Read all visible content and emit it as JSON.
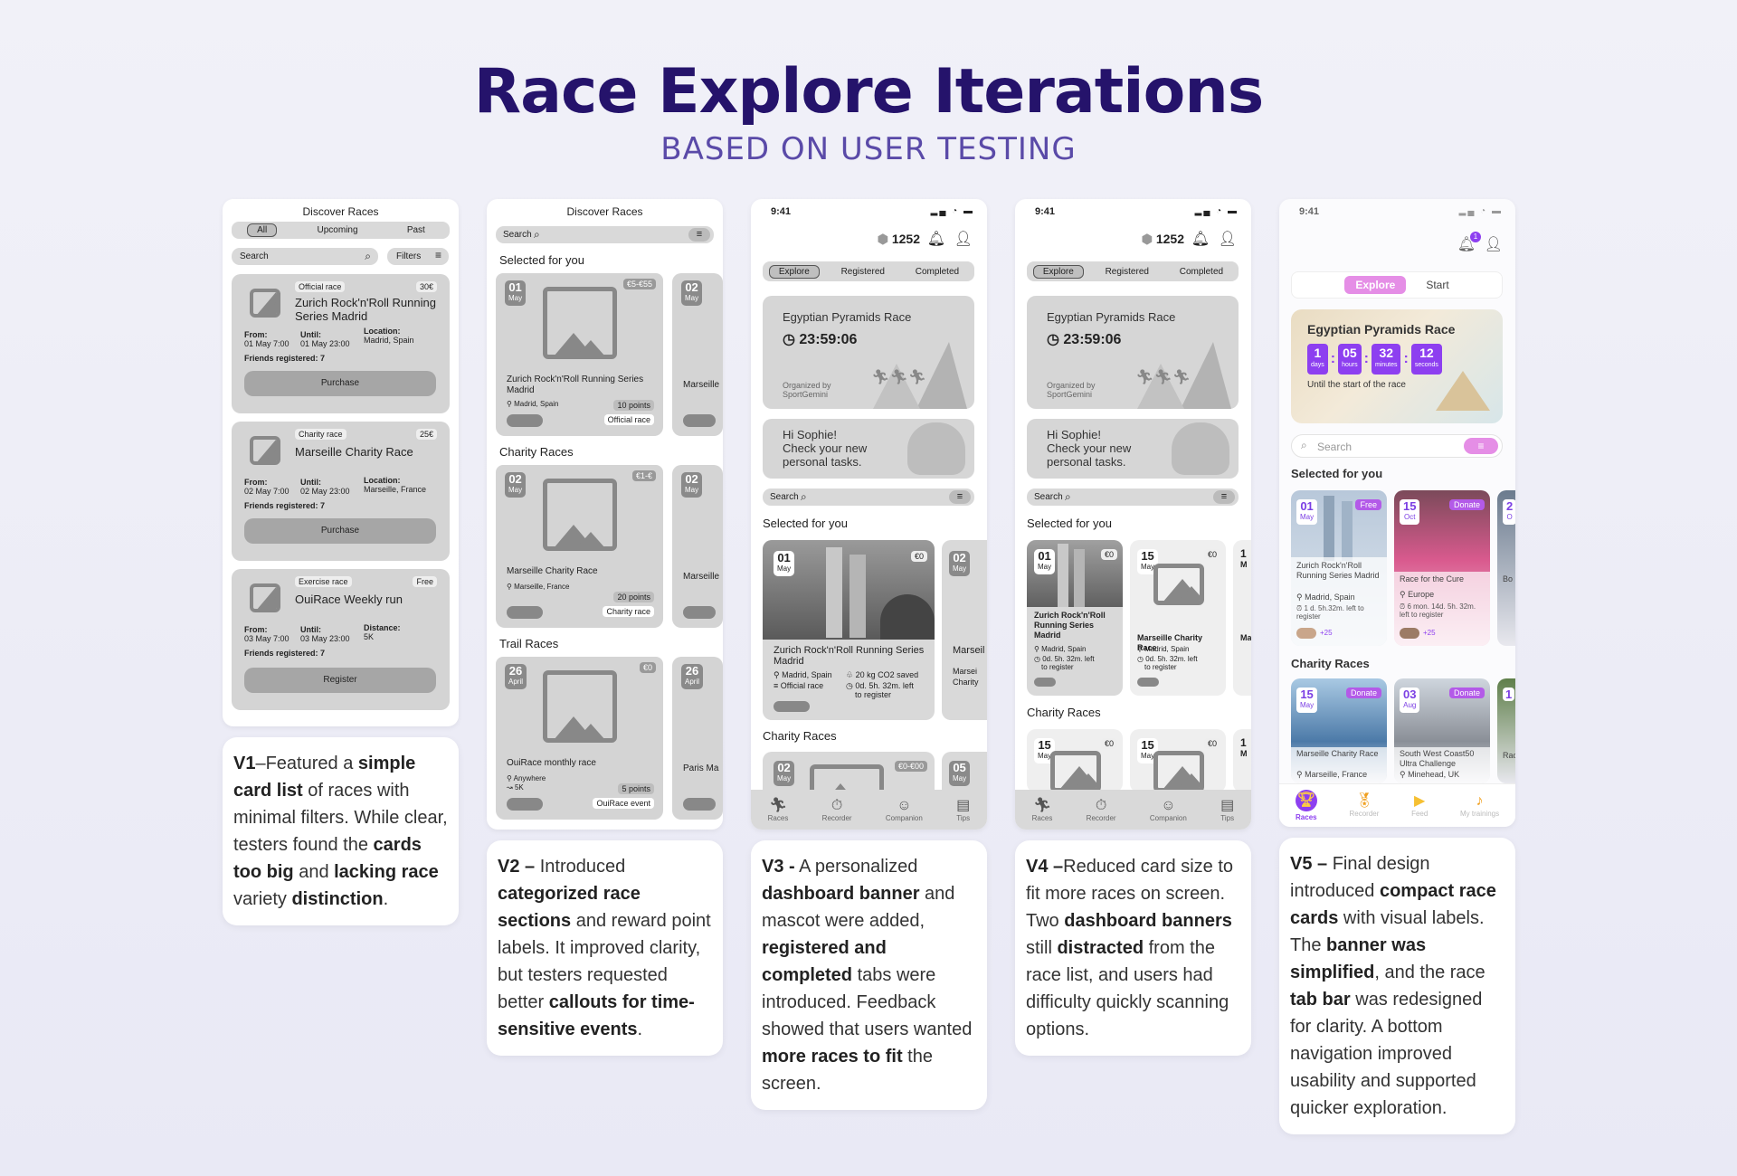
{
  "header": {
    "title": "Race Explore Iterations",
    "subtitle": "BASED ON USER TESTING"
  },
  "v1": {
    "title": "Discover Races",
    "tabs": [
      "All",
      "Upcoming",
      "Past"
    ],
    "search": "Search",
    "filters": "Filters",
    "cards": [
      {
        "tag": "Official race",
        "price": "30€",
        "name": "Zurich Rock'n'Roll Running Series Madrid",
        "from": "From:",
        "from_v": "01 May 7:00",
        "until": "Until:",
        "until_v": "01 May 23:00",
        "loc": "Location:",
        "loc_v": "Madrid, Spain",
        "friends": "Friends registered: 7",
        "btn": "Purchase"
      },
      {
        "tag": "Charity race",
        "price": "25€",
        "name": "Marseille Charity Race",
        "from": "From:",
        "from_v": "02 May 7:00",
        "until": "Until:",
        "until_v": "02 May 23:00",
        "loc": "Location:",
        "loc_v": "Marseille, France",
        "friends": "Friends registered: 7",
        "btn": "Purchase"
      },
      {
        "tag": "Exercise race",
        "price": "Free",
        "name": "OuiRace Weekly run",
        "from": "From:",
        "from_v": "03 May 7:00",
        "until": "Until:",
        "until_v": "03 May 23:00",
        "loc": "Distance:",
        "loc_v": "5K",
        "friends": "Friends registered: 7",
        "btn": "Register"
      }
    ],
    "desc_parts": [
      "V1",
      "–Featured a ",
      "simple card list",
      " of races with minimal filters. While clear, testers found the ",
      "cards too big",
      " and ",
      "lacking race",
      " variety ",
      "distinction",
      "."
    ]
  },
  "v2": {
    "title": "Discover Races",
    "search": "Search",
    "sections": [
      {
        "label": "Selected for you",
        "day": "01",
        "month": "May",
        "price": "€5-€55",
        "name": "Zurich Rock'n'Roll Running Series Madrid",
        "loc": "Madrid, Spain",
        "points": "10 points",
        "type": "Official race",
        "peek_day": "02",
        "peek_month": "May",
        "peek_name": "Marseille"
      },
      {
        "label": "Charity Races",
        "day": "02",
        "month": "May",
        "price": "€1-€",
        "name": "Marseille Charity Race",
        "loc": "Marseille, France",
        "points": "20 points",
        "type": "Charity race",
        "peek_day": "02",
        "peek_month": "May",
        "peek_name": "Marseille"
      },
      {
        "label": "Trail Races",
        "day": "26",
        "month": "April",
        "price": "€0",
        "name": "OuiRace monthly race",
        "loc": "Anywhere",
        "dist": "5K",
        "points": "5 points",
        "type": "OuiRace event",
        "peek_day": "26",
        "peek_month": "April",
        "peek_name": "Paris Ma"
      }
    ],
    "desc_parts": [
      "V2 –",
      " Introduced ",
      "categorized race sections",
      " and reward point labels. It improved clarity, but testers requested better ",
      "callouts for time-sensitive events",
      "."
    ]
  },
  "v3": {
    "time": "9:41",
    "coins": "1252",
    "tabs": [
      "Explore",
      "Registered",
      "Completed"
    ],
    "banner": {
      "title": "Egyptian Pyramids Race",
      "timer": "23:59:06",
      "org1": "Organized by",
      "org2": "SportGemini"
    },
    "mascot": {
      "l1": "Hi Sophie!",
      "l2": "Check your new",
      "l3": "personal tasks."
    },
    "search": "Search",
    "selected": "Selected for you",
    "card": {
      "day": "01",
      "month": "May",
      "price": "€0",
      "name": "Zurich Rock'n'Roll Running Series Madrid",
      "loc": "Madrid, Spain",
      "co2": "20 kg CO2 saved",
      "type": "Official race",
      "left1": "0d. 5h. 32m. left",
      "left2": "to register"
    },
    "peek": {
      "day": "02",
      "month": "May",
      "name": "Marseil",
      "loc": "Marsei",
      "type": "Charity"
    },
    "charity": "Charity Races",
    "charity_card": {
      "day": "02",
      "month": "May",
      "price": "€0-€00"
    },
    "charity_peek": {
      "day": "05",
      "month": "May"
    },
    "nav": [
      "Races",
      "Recorder",
      "Companion",
      "Tips"
    ],
    "desc_parts": [
      "V3 -",
      " A personalized ",
      "dashboard banner",
      " and mascot were added, ",
      "registered and completed",
      " tabs were introduced. Feedback showed that users wanted ",
      "more races to fit",
      " the screen."
    ]
  },
  "v4": {
    "time": "9:41",
    "coins": "1252",
    "tabs": [
      "Explore",
      "Registered",
      "Completed"
    ],
    "banner": {
      "title": "Egyptian Pyramids Race",
      "timer": "23:59:06",
      "org1": "Organized by",
      "org2": "SportGemini"
    },
    "mascot": {
      "l1": "Hi Sophie!",
      "l2": "Check your new",
      "l3": "personal tasks."
    },
    "search": "Search",
    "selected": "Selected for you",
    "cards": [
      {
        "day": "01",
        "month": "May",
        "price": "€0",
        "name": "Zurich Rock'n'Roll Running Series Madrid",
        "loc": "Madrid, Spain",
        "left1": "0d. 5h. 32m. left",
        "left2": "to register"
      },
      {
        "day": "15",
        "month": "May",
        "price": "€0",
        "name": "Marseille Charity Race",
        "loc": "Madrid, Spain",
        "left1": "0d. 5h. 32m. left",
        "left2": "to register"
      }
    ],
    "peek": {
      "day": "1",
      "month": "M",
      "name": "Ma"
    },
    "charity": "Charity Races",
    "charity_cards": [
      {
        "day": "15",
        "month": "May",
        "price": "€0"
      },
      {
        "day": "15",
        "month": "May",
        "price": "€0"
      }
    ],
    "charity_peek": {
      "day": "1",
      "month": "M"
    },
    "nav": [
      "Races",
      "Recorder",
      "Companion",
      "Tips"
    ],
    "desc_parts": [
      "V4 –",
      "Reduced card size to fit more races on screen. Two ",
      "dashboard banners",
      " still ",
      "distracted",
      " from the race list, and users had difficulty quickly scanning options."
    ]
  },
  "v5": {
    "time": "9:41",
    "badge": "1",
    "tabs": [
      "Explore",
      "Start"
    ],
    "banner": {
      "title": "Egyptian Pyramids Race",
      "cd": [
        {
          "v": "1",
          "u": "days"
        },
        {
          "v": "05",
          "u": "hours"
        },
        {
          "v": "32",
          "u": "minutes"
        },
        {
          "v": "12",
          "u": "seconds"
        }
      ],
      "sub": "Until the start of the race"
    },
    "search": "Search",
    "selected": "Selected for you",
    "cards": [
      {
        "day": "01",
        "month": "May",
        "tag": "Free",
        "name": "Zurich Rock'n'Roll Running Series Madrid",
        "loc": "Madrid, Spain",
        "left": "1 d. 5h.32m. left to register",
        "plus": "+25"
      },
      {
        "day": "15",
        "month": "Oct",
        "tag": "Donate",
        "name": "Race for the Cure",
        "loc": "Europe",
        "left": "6 mon. 14d. 5h. 32m. left to register",
        "plus": "+25"
      }
    ],
    "peek": {
      "day": "2",
      "month": "O",
      "name": "Bo"
    },
    "charity": "Charity Races",
    "charity_cards": [
      {
        "day": "15",
        "month": "May",
        "tag": "Donate",
        "name": "Marseille Charity Race",
        "loc": "Marseille, France"
      },
      {
        "day": "03",
        "month": "Aug",
        "tag": "Donate",
        "name": "South West Coast50 Ultra Challenge",
        "loc": "Minehead, UK"
      }
    ],
    "charity_peek": {
      "day": "1",
      "name": "Rac"
    },
    "nav": [
      "Races",
      "Recorder",
      "Feed",
      "My trainings"
    ],
    "desc_parts": [
      "V5 –",
      " Final design introduced ",
      "compact race cards",
      " with visual labels. The ",
      "banner was simplified",
      ", and the race ",
      "tab bar",
      " was redesigned for clarity. A bottom navigation improved usability and supported quicker exploration."
    ]
  }
}
